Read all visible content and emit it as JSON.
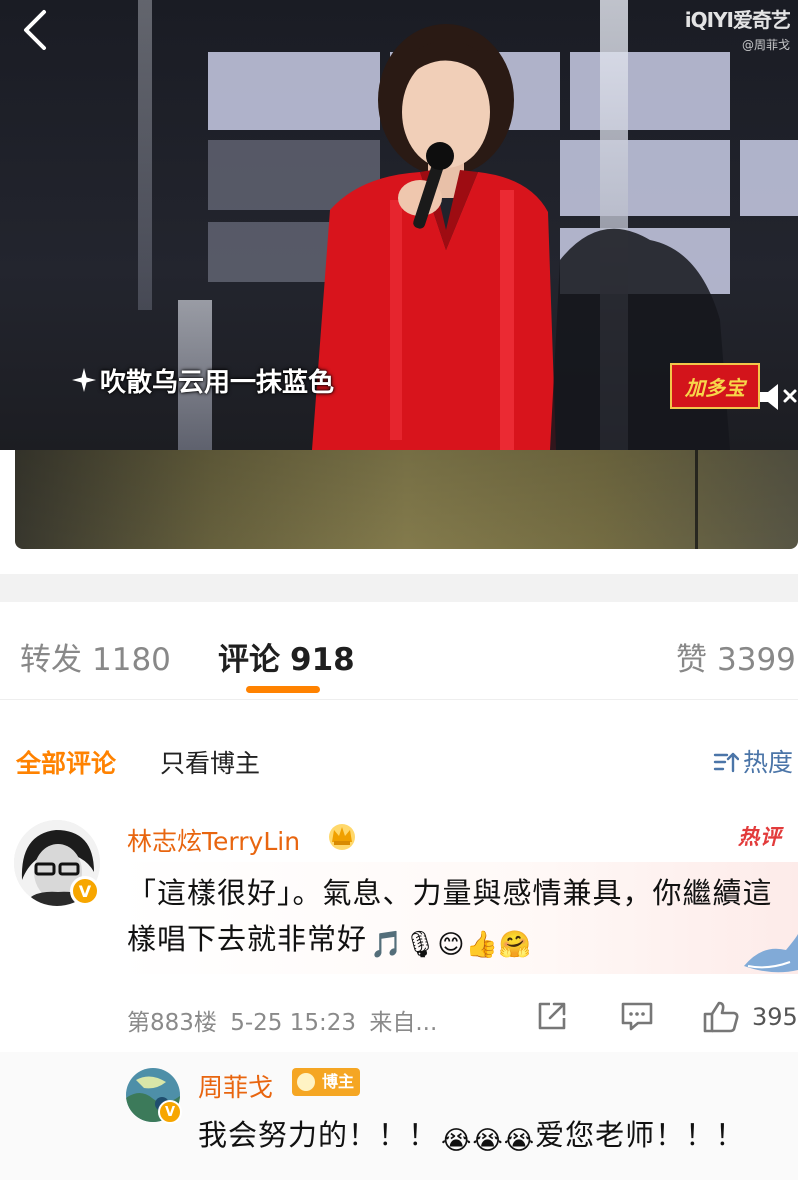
{
  "video": {
    "subtitle": "吹散乌云用一抹蓝色",
    "watermark": "iQIYI爱奇艺",
    "watermark_sub": "@周菲戈",
    "show_badge": "加多宝"
  },
  "tabs": [
    {
      "label": "转发",
      "count": "1180",
      "active": false
    },
    {
      "label": "评论",
      "count": "918",
      "active": true
    },
    {
      "label": "赞",
      "count": "3399",
      "active": false
    }
  ],
  "filter": {
    "all_comments": "全部评论",
    "only_author": "只看博主",
    "sort": "热度"
  },
  "comment": {
    "user": "林志炫TerryLin",
    "hot_tag": "热评",
    "text": "「這樣很好」。氣息、力量與感情兼具，你繼續這樣唱下去就非常好",
    "emojis": "🎵🎙😊👍🤗",
    "floor": "第883楼",
    "time": "5-25 15:23",
    "source": "来自...",
    "likes": "395"
  },
  "reply": {
    "user": "周菲戈",
    "badge": "博主",
    "text_a": "我会努力的！！！",
    "emojis": "😭😭😭",
    "text_b": "爱您老师！！！"
  },
  "colors": {
    "accent": "#ff8200",
    "username": "#e8650f",
    "link_blue": "#4b75a8",
    "hot_red": "#e23b3b"
  },
  "icons": [
    "back-arrow-icon",
    "spark-icon",
    "mute-icon",
    "sort-icon",
    "crown-icon",
    "verified-icon",
    "share-icon",
    "comment-icon",
    "like-icon",
    "whale-icon"
  ]
}
